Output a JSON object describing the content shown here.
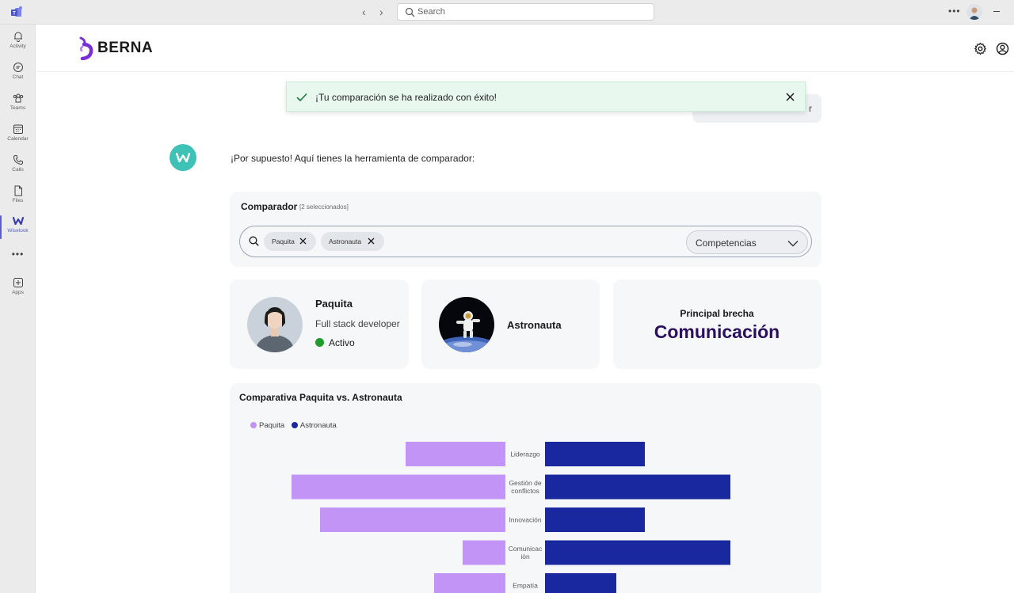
{
  "titlebar": {
    "search_placeholder": "Search"
  },
  "rail": {
    "items": [
      {
        "label": "Activity"
      },
      {
        "label": "Chat"
      },
      {
        "label": "Teams"
      },
      {
        "label": "Calendar"
      },
      {
        "label": "Calls"
      },
      {
        "label": "Files"
      },
      {
        "label": "Wiselook"
      },
      {
        "label": "Apps"
      }
    ],
    "more": "•••"
  },
  "header": {
    "brand": "BERNA"
  },
  "toast": {
    "message": "¡Tu comparación se ha realizado con éxito!"
  },
  "user_message_visible_tail": "r",
  "bot": {
    "message": "¡Por supuesto! Aquí tienes la herramienta de comparador:"
  },
  "comparator": {
    "title": "Comparador",
    "subtitle": "[2 seleccionados]",
    "chips": [
      {
        "label": "Paquita"
      },
      {
        "label": "Astronauta"
      }
    ],
    "dropdown_value": "Competencias"
  },
  "cards": {
    "person1": {
      "name": "Paquita",
      "role": "Full stack developer",
      "status": "Activo",
      "status_color": "#1f9d2a"
    },
    "person2": {
      "name": "Astronauta"
    },
    "gap": {
      "label": "Principal brecha",
      "value": "Comunicación"
    }
  },
  "chart_data": {
    "type": "bar",
    "title": "Comparativa Paquita vs. Astronauta",
    "legend_position": "top-left",
    "categories": [
      "Liderazgo",
      "Gestión de conflictos",
      "Innovación",
      "Comunicación",
      "Empatía"
    ],
    "category_label_lines": [
      [
        "Liderazgo"
      ],
      [
        "Gestión de",
        "conflictos"
      ],
      [
        "Innovación"
      ],
      [
        "Comunicac",
        "ión"
      ],
      [
        "Empatía"
      ]
    ],
    "series": [
      {
        "name": "Paquita",
        "color": "#c194f5",
        "values": [
          7,
          15,
          13,
          3,
          5
        ]
      },
      {
        "name": "Astronauta",
        "color": "#1a28a0",
        "values": [
          7,
          13,
          7,
          13,
          5
        ]
      }
    ],
    "xlim": [
      0,
      15
    ]
  }
}
